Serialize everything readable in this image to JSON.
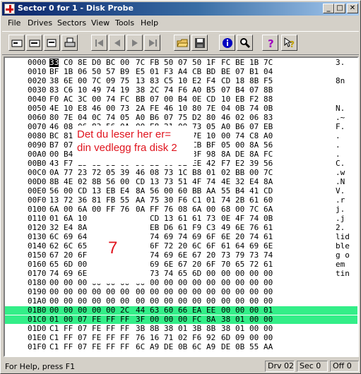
{
  "window": {
    "title": "Sector 0 for 1 - Disk Probe"
  },
  "title_buttons": [
    "_",
    "□",
    "✕"
  ],
  "menu": [
    "File",
    "Drives",
    "Sectors",
    "View",
    "Tools",
    "Help"
  ],
  "toolbar_icons": [
    "read-sector-icon",
    "write-sector-icon",
    "copy-icon",
    "print-icon",
    "first-sector-icon",
    "previous-sector-icon",
    "next-sector-icon",
    "last-sector-icon",
    "open-icon",
    "save-icon",
    "info-icon",
    "search-icon",
    "help-icon",
    "context-help-icon"
  ],
  "hex": {
    "rows": [
      {
        "off": "0000",
        "bytes": [
          "33",
          "C0",
          "8E",
          "D0",
          "BC",
          "00",
          "7C",
          "FB",
          "50",
          "07",
          "50",
          "1F",
          "FC",
          "BE",
          "1B",
          "7C"
        ],
        "ascii": "3."
      },
      {
        "off": "0010",
        "bytes": [
          "BF",
          "1B",
          "06",
          "50",
          "57",
          "B9",
          "E5",
          "01",
          "F3",
          "A4",
          "CB",
          "BD",
          "BE",
          "07",
          "B1",
          "04"
        ],
        "ascii": ""
      },
      {
        "off": "0020",
        "bytes": [
          "38",
          "6E",
          "00",
          "7C",
          "09",
          "75",
          "13",
          "83",
          "C5",
          "10",
          "E2",
          "F4",
          "CD",
          "18",
          "8B",
          "F5"
        ],
        "ascii": "8n"
      },
      {
        "off": "0030",
        "bytes": [
          "83",
          "C6",
          "10",
          "49",
          "74",
          "19",
          "38",
          "2C",
          "74",
          "F6",
          "A0",
          "B5",
          "07",
          "B4",
          "07",
          "8B"
        ],
        "ascii": ""
      },
      {
        "off": "0040",
        "bytes": [
          "F0",
          "AC",
          "3C",
          "00",
          "74",
          "FC",
          "BB",
          "07",
          "00",
          "B4",
          "0E",
          "CD",
          "10",
          "EB",
          "F2",
          "88"
        ],
        "ascii": ""
      },
      {
        "off": "0050",
        "bytes": [
          "4E",
          "10",
          "E8",
          "46",
          "00",
          "73",
          "2A",
          "FE",
          "46",
          "10",
          "80",
          "7E",
          "04",
          "0B",
          "74",
          "0B"
        ],
        "ascii": "N."
      },
      {
        "off": "0060",
        "bytes": [
          "80",
          "7E",
          "04",
          "0C",
          "74",
          "05",
          "A0",
          "B6",
          "07",
          "75",
          "D2",
          "80",
          "46",
          "02",
          "06",
          "83"
        ],
        "ascii": ".~"
      },
      {
        "off": "0070",
        "bytes": [
          "46",
          "08",
          "06",
          "83",
          "56",
          "0A",
          "00",
          "E8",
          "21",
          "00",
          "73",
          "05",
          "A0",
          "B6",
          "07",
          "EB"
        ],
        "ascii": "F."
      },
      {
        "off": "0080",
        "bytes": [
          "BC",
          "81",
          "3E",
          "FE",
          "7D",
          "55",
          "AA",
          "74",
          "0B",
          "80",
          "7E",
          "10",
          "00",
          "74",
          "C8",
          "A0"
        ],
        "ascii": "."
      },
      {
        "off": "0090",
        "bytes": [
          "B7",
          "07",
          "EB",
          "A9",
          "8B",
          "FC",
          "1E",
          "57",
          "8B",
          "F5",
          "CB",
          "BF",
          "05",
          "00",
          "8A",
          "56"
        ],
        "ascii": "."
      },
      {
        "off": "00A0",
        "bytes": [
          "00",
          "B4",
          "08",
          "CD",
          "13",
          "72",
          "23",
          "8A",
          "C1",
          "24",
          "3F",
          "98",
          "8A",
          "DE",
          "8A",
          "FC"
        ],
        "ascii": "."
      },
      {
        "off": "00B0",
        "bytes": [
          "43",
          "F7",
          "E3",
          "8B",
          "D1",
          "86",
          "D6",
          "B1",
          "06",
          "D2",
          "EE",
          "42",
          "F7",
          "E2",
          "39",
          "56"
        ],
        "ascii": "C."
      },
      {
        "off": "00C0",
        "bytes": [
          "0A",
          "77",
          "23",
          "72",
          "05",
          "39",
          "46",
          "08",
          "73",
          "1C",
          "B8",
          "01",
          "02",
          "BB",
          "00",
          "7C"
        ],
        "ascii": ".w"
      },
      {
        "off": "00D0",
        "bytes": [
          "8B",
          "4E",
          "02",
          "8B",
          "56",
          "00",
          "CD",
          "13",
          "73",
          "51",
          "4F",
          "74",
          "4E",
          "32",
          "E4",
          "8A"
        ],
        "ascii": ".N"
      },
      {
        "off": "00E0",
        "bytes": [
          "56",
          "00",
          "CD",
          "13",
          "EB",
          "E4",
          "8A",
          "56",
          "00",
          "60",
          "BB",
          "AA",
          "55",
          "B4",
          "41",
          "CD"
        ],
        "ascii": "V."
      },
      {
        "off": "00F0",
        "bytes": [
          "13",
          "72",
          "36",
          "81",
          "FB",
          "55",
          "AA",
          "75",
          "30",
          "F6",
          "C1",
          "01",
          "74",
          "2B",
          "61",
          "60"
        ],
        "ascii": ".r"
      },
      {
        "off": "0100",
        "bytes": [
          "6A",
          "00",
          "6A",
          "00",
          "FF",
          "76",
          "0A",
          "FF",
          "76",
          "08",
          "6A",
          "00",
          "68",
          "00",
          "7C",
          "6A"
        ],
        "ascii": "j."
      },
      {
        "off": "0110",
        "bytes": [
          "01",
          "6A",
          "10",
          "B4",
          "42",
          "8B",
          "F4",
          "CD",
          "13",
          "61",
          "61",
          "73",
          "0E",
          "4F",
          "74",
          "0B"
        ],
        "ascii": ".j"
      },
      {
        "off": "0120",
        "bytes": [
          "32",
          "E4",
          "8A",
          "56",
          "00",
          "CD",
          "13",
          "EB",
          "D6",
          "61",
          "F9",
          "C3",
          "49",
          "6E",
          "76",
          "61"
        ],
        "ascii": "2."
      },
      {
        "off": "0130",
        "bytes": [
          "6C",
          "69",
          "64",
          "20",
          "70",
          "61",
          "72",
          "74",
          "69",
          "74",
          "69",
          "6F",
          "6E",
          "20",
          "74",
          "61"
        ],
        "ascii": "lid"
      },
      {
        "off": "0140",
        "bytes": [
          "62",
          "6C",
          "65",
          "00",
          "45",
          "72",
          "72",
          "6F",
          "72",
          "20",
          "6C",
          "6F",
          "61",
          "64",
          "69",
          "6E"
        ],
        "ascii": "ble"
      },
      {
        "off": "0150",
        "bytes": [
          "67",
          "20",
          "6F",
          "70",
          "65",
          "72",
          "61",
          "74",
          "69",
          "6E",
          "67",
          "20",
          "73",
          "79",
          "73",
          "74"
        ],
        "ascii": "g o"
      },
      {
        "off": "0160",
        "bytes": [
          "65",
          "6D",
          "00",
          "4D",
          "69",
          "73",
          "73",
          "69",
          "6E",
          "67",
          "20",
          "6F",
          "70",
          "65",
          "72",
          "61"
        ],
        "ascii": "em"
      },
      {
        "off": "0170",
        "bytes": [
          "74",
          "69",
          "6E",
          "67",
          "20",
          "73",
          "79",
          "73",
          "74",
          "65",
          "6D",
          "00",
          "00",
          "00",
          "00",
          "00"
        ],
        "ascii": "tin"
      },
      {
        "off": "0180",
        "bytes": [
          "00",
          "00",
          "00",
          "00",
          "00",
          "00",
          "00",
          "00",
          "00",
          "00",
          "00",
          "00",
          "00",
          "00",
          "00",
          "00"
        ],
        "ascii": ""
      },
      {
        "off": "0190",
        "bytes": [
          "00",
          "00",
          "00",
          "00",
          "00",
          "00",
          "00",
          "00",
          "00",
          "00",
          "00",
          "00",
          "00",
          "00",
          "00",
          "00"
        ],
        "ascii": ""
      },
      {
        "off": "01A0",
        "bytes": [
          "00",
          "00",
          "00",
          "00",
          "00",
          "00",
          "00",
          "00",
          "00",
          "00",
          "00",
          "00",
          "00",
          "00",
          "00",
          "00"
        ],
        "ascii": ""
      },
      {
        "off": "01B0",
        "bytes": [
          "00",
          "00",
          "00",
          "00",
          "00",
          "2C",
          "44",
          "63",
          "60",
          "66",
          "EA",
          "EE",
          "00",
          "00",
          "00",
          "01"
        ],
        "ascii": "",
        "hl": true
      },
      {
        "off": "01C0",
        "bytes": [
          "01",
          "00",
          "07",
          "FE",
          "FF",
          "FF",
          "3F",
          "00",
          "00",
          "00",
          "FC",
          "8A",
          "38",
          "01",
          "00",
          "00"
        ],
        "ascii": "",
        "hl": true
      },
      {
        "off": "01D0",
        "bytes": [
          "C1",
          "FF",
          "07",
          "FE",
          "FF",
          "FF",
          "3B",
          "8B",
          "38",
          "01",
          "3B",
          "8B",
          "38",
          "01",
          "00",
          "00"
        ],
        "ascii": ""
      },
      {
        "off": "01E0",
        "bytes": [
          "C1",
          "FF",
          "07",
          "FE",
          "FF",
          "FF",
          "76",
          "16",
          "71",
          "02",
          "F6",
          "92",
          "6D",
          "09",
          "00",
          "00"
        ],
        "ascii": ""
      },
      {
        "off": "01F0",
        "bytes": [
          "C1",
          "FF",
          "07",
          "FE",
          "FF",
          "FF",
          "6C",
          "A9",
          "DE",
          "0B",
          "6C",
          "A9",
          "DE",
          "0B",
          "55",
          "AA"
        ],
        "ascii": ""
      }
    ]
  },
  "overlay": {
    "line1": "Det du leser her er=",
    "line2": "din vedlegg fra disk 2",
    "number": "7"
  },
  "status": {
    "help": "For Help, press F1",
    "drive": "Drv  02",
    "sector": "Sec 0",
    "offset": "Off 0"
  }
}
